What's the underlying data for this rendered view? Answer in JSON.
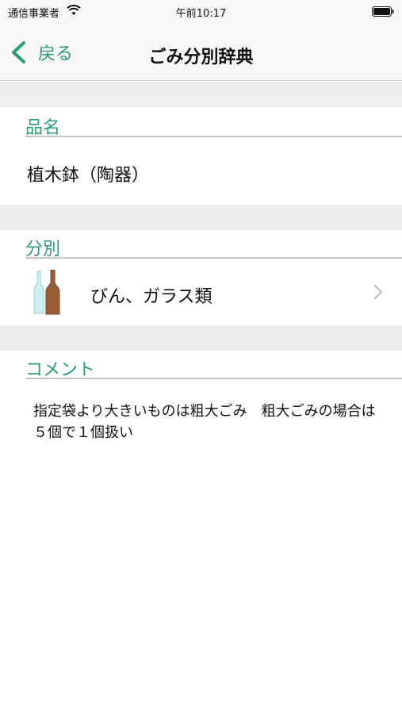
{
  "status_bar": {
    "carrier": "通信事業者",
    "time": "午前10:17"
  },
  "nav": {
    "back_label": "戻る",
    "title": "ごみ分別辞典"
  },
  "sections": {
    "name_header": "品名",
    "name_value": "植木鉢（陶器）",
    "category_header": "分別",
    "category_value": "びん、ガラス類",
    "comment_header": "コメント",
    "comment_text": "指定袋より大きいものは粗大ごみ　粗大ごみの場合は５個で１個扱い"
  },
  "colors": {
    "accent": "#2a9d78",
    "gap": "#efefef"
  }
}
